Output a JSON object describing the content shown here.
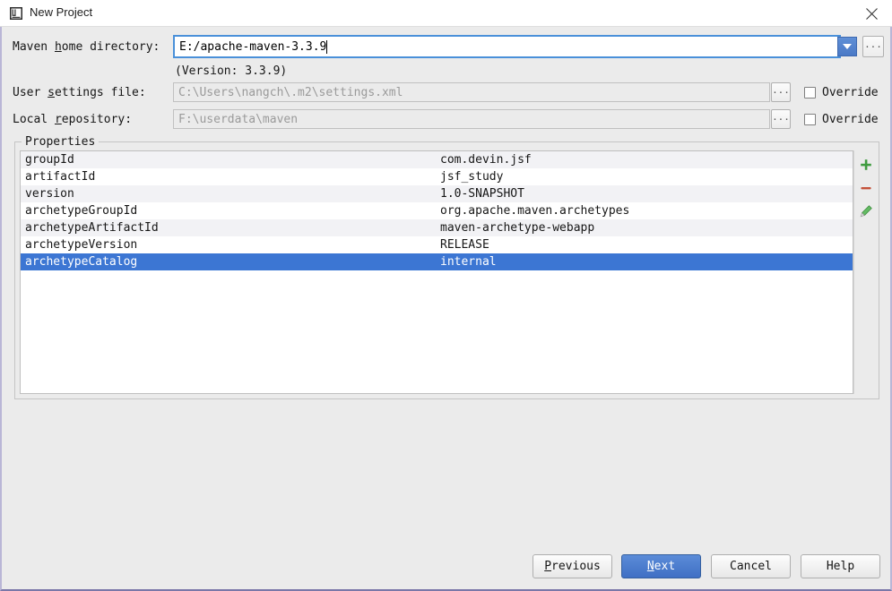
{
  "window": {
    "title": "New Project",
    "app_icon": "intellij-idea-icon",
    "close_icon": "close-icon"
  },
  "form": {
    "maven_home": {
      "label_prefix": "Maven ",
      "label_mnemonic": "h",
      "label_suffix": "ome directory:",
      "value": "E:/apache-maven-3.3.9",
      "dropdown_icon": "chevron-down-icon",
      "browse_label": "...",
      "version_note": "(Version: 3.3.9)"
    },
    "user_settings": {
      "label_prefix": "User ",
      "label_mnemonic": "s",
      "label_suffix": "ettings file:",
      "value": "C:\\Users\\nangch\\.m2\\settings.xml",
      "browse_label": "...",
      "override_label": "Override",
      "override_checked": false
    },
    "local_repository": {
      "label_prefix": "Local ",
      "label_mnemonic": "r",
      "label_suffix": "epository:",
      "value": "F:\\userdata\\maven",
      "browse_label": "...",
      "override_label": "Override",
      "override_checked": false
    }
  },
  "properties": {
    "legend": "Properties",
    "rows": [
      {
        "key": "groupId",
        "value": "com.devin.jsf"
      },
      {
        "key": "artifactId",
        "value": "jsf_study"
      },
      {
        "key": "version",
        "value": "1.0-SNAPSHOT"
      },
      {
        "key": "archetypeGroupId",
        "value": "org.apache.maven.archetypes"
      },
      {
        "key": "archetypeArtifactId",
        "value": "maven-archetype-webapp"
      },
      {
        "key": "archetypeVersion",
        "value": "RELEASE"
      },
      {
        "key": "archetypeCatalog",
        "value": "internal"
      }
    ],
    "selected_index": 6,
    "toolbar": [
      {
        "icon": "add-icon",
        "color": "#3f9c3f"
      },
      {
        "icon": "remove-icon",
        "color": "#c4513a"
      },
      {
        "icon": "edit-icon",
        "color": "#4aa14a"
      }
    ]
  },
  "footer": {
    "previous": {
      "prefix": "",
      "mnemonic": "P",
      "suffix": "revious"
    },
    "next": {
      "prefix": "",
      "mnemonic": "N",
      "suffix": "ext"
    },
    "cancel": {
      "label": "Cancel"
    },
    "help": {
      "label": "Help"
    }
  },
  "colors": {
    "selection_blue": "#3c76d3",
    "default_button_blue": "#4a79c6",
    "dialog_bg": "#ebebeb",
    "add_green": "#3f9c3f",
    "remove_red": "#c4513a"
  }
}
